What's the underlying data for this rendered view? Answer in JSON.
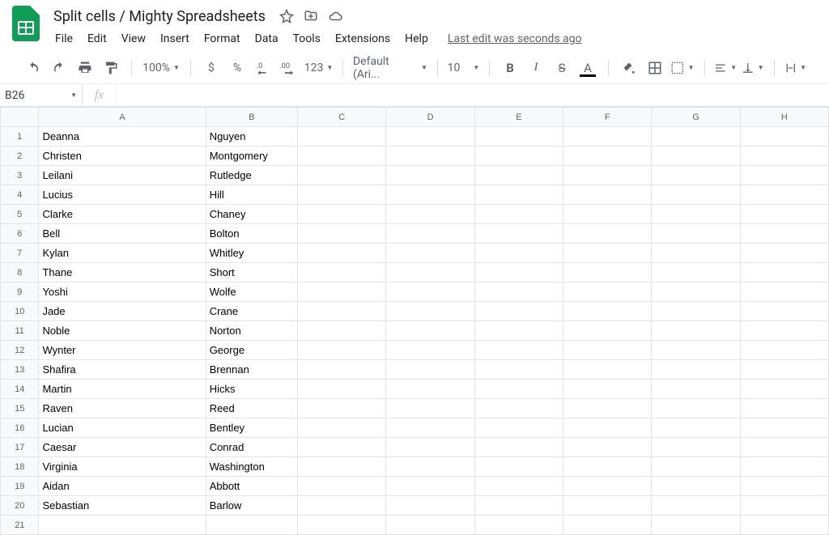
{
  "doc": {
    "title": "Split cells / Mighty Spreadsheets",
    "last_edit": "Last edit was seconds ago"
  },
  "menus": [
    "File",
    "Edit",
    "View",
    "Insert",
    "Format",
    "Data",
    "Tools",
    "Extensions",
    "Help"
  ],
  "toolbar": {
    "zoom": "100%",
    "currency": "$",
    "percent": "%",
    "dec_less": ".0",
    "dec_more": ".00",
    "more_formats": "123",
    "font": "Default (Ari...",
    "font_size": "10"
  },
  "name_box": "B26",
  "fx_label": "fx",
  "columns": [
    "A",
    "B",
    "C",
    "D",
    "E",
    "F",
    "G",
    "H"
  ],
  "rows": [
    {
      "n": "1",
      "a": "Deanna",
      "b": "Nguyen"
    },
    {
      "n": "2",
      "a": "Christen",
      "b": "Montgomery"
    },
    {
      "n": "3",
      "a": "Leilani",
      "b": "Rutledge"
    },
    {
      "n": "4",
      "a": "Lucius",
      "b": "Hill"
    },
    {
      "n": "5",
      "a": "Clarke",
      "b": "Chaney"
    },
    {
      "n": "6",
      "a": "Bell",
      "b": "Bolton"
    },
    {
      "n": "7",
      "a": "Kylan",
      "b": "Whitley"
    },
    {
      "n": "8",
      "a": "Thane",
      "b": "Short"
    },
    {
      "n": "9",
      "a": "Yoshi",
      "b": "Wolfe"
    },
    {
      "n": "10",
      "a": "Jade",
      "b": "Crane"
    },
    {
      "n": "11",
      "a": "Noble",
      "b": "Norton"
    },
    {
      "n": "12",
      "a": "Wynter",
      "b": "George"
    },
    {
      "n": "13",
      "a": "Shafira",
      "b": "Brennan"
    },
    {
      "n": "14",
      "a": "Martin",
      "b": "Hicks"
    },
    {
      "n": "15",
      "a": "Raven",
      "b": "Reed"
    },
    {
      "n": "16",
      "a": "Lucian",
      "b": "Bentley"
    },
    {
      "n": "17",
      "a": "Caesar",
      "b": "Conrad"
    },
    {
      "n": "18",
      "a": "Virginia",
      "b": "Washington"
    },
    {
      "n": "19",
      "a": "Aidan",
      "b": "Abbott"
    },
    {
      "n": "20",
      "a": "Sebastian",
      "b": "Barlow"
    },
    {
      "n": "21",
      "a": "",
      "b": ""
    }
  ]
}
